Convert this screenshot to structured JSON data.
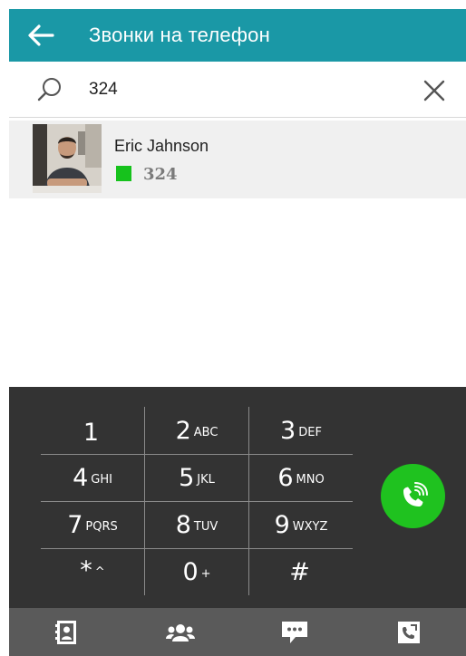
{
  "header": {
    "title": "Звонки на телефон",
    "back_icon": "arrow-left-icon"
  },
  "search": {
    "value": "324",
    "placeholder": "",
    "search_icon": "search-icon",
    "clear_icon": "close-icon"
  },
  "results": [
    {
      "name": "Eric Jahnson",
      "number": "324",
      "status_color": "#16c21c"
    }
  ],
  "dialpad": {
    "keys": [
      {
        "digit": "1",
        "letters": ""
      },
      {
        "digit": "2",
        "letters": "ABC"
      },
      {
        "digit": "3",
        "letters": "DEF"
      },
      {
        "digit": "4",
        "letters": "GHI"
      },
      {
        "digit": "5",
        "letters": "JKL"
      },
      {
        "digit": "6",
        "letters": "MNO"
      },
      {
        "digit": "7",
        "letters": "PQRS"
      },
      {
        "digit": "8",
        "letters": "TUV"
      },
      {
        "digit": "9",
        "letters": "WXYZ"
      },
      {
        "digit": "*",
        "letters": "^"
      },
      {
        "digit": "0",
        "letters": "+"
      },
      {
        "digit": "#",
        "letters": ""
      }
    ],
    "call_icon": "phone-call-icon"
  },
  "bottom_tabs": [
    {
      "icon": "contacts-book-icon"
    },
    {
      "icon": "group-icon"
    },
    {
      "icon": "chat-icon"
    },
    {
      "icon": "dialer-icon"
    }
  ],
  "colors": {
    "accent": "#1a98a6",
    "call_green": "#1fc21f",
    "dialpad_bg": "#333333",
    "tabbar_bg": "#5a5a5a"
  }
}
